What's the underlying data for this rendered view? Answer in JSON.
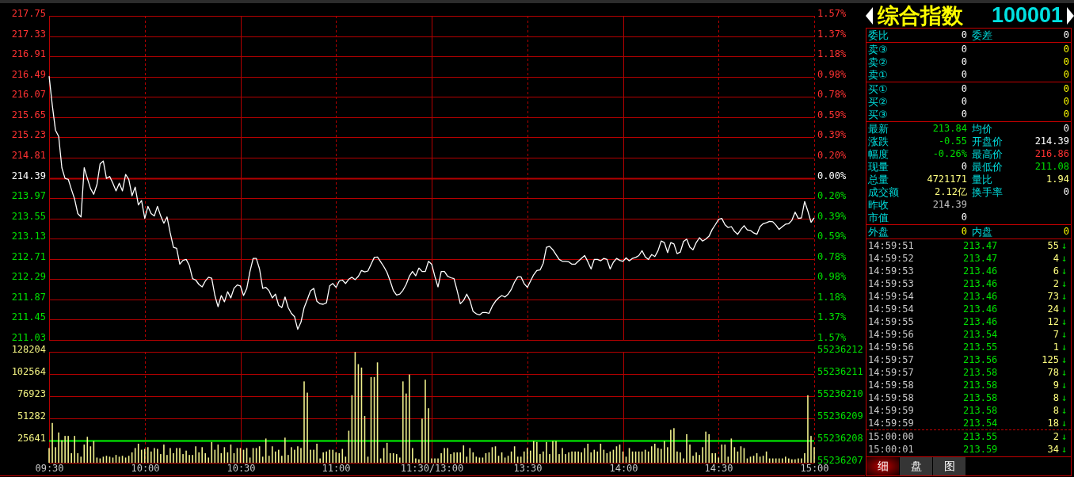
{
  "price_chart": {
    "chart_data": {
      "type": "line",
      "grid": true,
      "categories": [
        null,
        null,
        null,
        null,
        null,
        null,
        null,
        null,
        null,
        null,
        null,
        null,
        null,
        null,
        null,
        null,
        null,
        null,
        null,
        null,
        null,
        null,
        null,
        null,
        null,
        null,
        null,
        null,
        null,
        null,
        null,
        null,
        null,
        null,
        null,
        null,
        null,
        null,
        null,
        null,
        null,
        null,
        null,
        null,
        null,
        null,
        null,
        null,
        null,
        null,
        null,
        null,
        null,
        null,
        null,
        null,
        null,
        null,
        null,
        null,
        null,
        null,
        null,
        null,
        null,
        null,
        null,
        null,
        null,
        null,
        null,
        null,
        null,
        null,
        null,
        null,
        null,
        null,
        null,
        null,
        null,
        null,
        null,
        null,
        null,
        null,
        null,
        null,
        null,
        null,
        null,
        null,
        null,
        null,
        null,
        null,
        null,
        null,
        null,
        null,
        null,
        null,
        null,
        null,
        null,
        null,
        null,
        null,
        null,
        null,
        null,
        null,
        null,
        null,
        null,
        null,
        null,
        null,
        null,
        null,
        null,
        null,
        null,
        null,
        null,
        null,
        null,
        null,
        null,
        null,
        null,
        null,
        null,
        null,
        null,
        null,
        null,
        null,
        null,
        null,
        null,
        null,
        null,
        null,
        null,
        null,
        null,
        null,
        null,
        null,
        null,
        null,
        null,
        null,
        null,
        null,
        null,
        null,
        null,
        null,
        null,
        null,
        null,
        null,
        null,
        null,
        null,
        null,
        null,
        null,
        null,
        null,
        null,
        null,
        null,
        null,
        null,
        null,
        null,
        null,
        null,
        null,
        null,
        null,
        null,
        null,
        null,
        null,
        null,
        null,
        null,
        null,
        null,
        null,
        null,
        null,
        null,
        null,
        null,
        null,
        null,
        null,
        null,
        null,
        null,
        null,
        null,
        null,
        null,
        null,
        null,
        null,
        null,
        null,
        null,
        null,
        null,
        null,
        null,
        null,
        null,
        null,
        null,
        null,
        null,
        null,
        null,
        null,
        null,
        null,
        null,
        null,
        null,
        null,
        null,
        null,
        null,
        null,
        null,
        null,
        null
      ],
      "series": [
        {
          "color": "#ffffff",
          "values": [
            216.5,
            215.9,
            215.38,
            215.25,
            214.6,
            214.38,
            214.36,
            214.15,
            213.95,
            213.65,
            213.58,
            214.6,
            214.38,
            214.17,
            214.05,
            214.25,
            214.68,
            214.74,
            214.38,
            214.42,
            214.28,
            214.12,
            214.28,
            214.12,
            214.46,
            214.36,
            214.02,
            214.2,
            213.83,
            213.92,
            213.55,
            213.8,
            213.65,
            213.6,
            213.8,
            213.6,
            213.45,
            213.58,
            213.25,
            212.95,
            212.93,
            212.6,
            212.68,
            212.7,
            212.57,
            212.3,
            212.27,
            212.18,
            212.13,
            212.25,
            212.33,
            212.31,
            211.95,
            211.72,
            211.95,
            211.82,
            212.03,
            211.9,
            212.1,
            212.17,
            212.15,
            211.95,
            212.1,
            212.45,
            212.72,
            212.72,
            212.5,
            212.1,
            212.12,
            212.05,
            211.9,
            211.98,
            211.75,
            211.7,
            211.92,
            211.7,
            211.58,
            211.51,
            211.25,
            211.4,
            211.7,
            211.87,
            212.05,
            212.1,
            211.83,
            211.78,
            211.77,
            211.8,
            212.15,
            212.2,
            212.12,
            212.25,
            212.27,
            212.2,
            212.29,
            212.33,
            212.28,
            212.35,
            212.47,
            212.44,
            212.46,
            212.6,
            212.74,
            212.75,
            212.65,
            212.55,
            212.43,
            212.25,
            212.05,
            211.96,
            211.98,
            212.06,
            212.18,
            212.35,
            212.45,
            212.36,
            212.52,
            212.45,
            212.45,
            212.66,
            212.6,
            212.35,
            212.13,
            212.45,
            212.45,
            212.35,
            212.32,
            212.3,
            212.05,
            211.78,
            211.85,
            211.98,
            211.85,
            211.62,
            211.57,
            211.55,
            211.6,
            211.6,
            211.58,
            211.73,
            211.83,
            211.9,
            211.95,
            211.92,
            211.98,
            212.08,
            212.23,
            212.34,
            212.34,
            212.2,
            212.12,
            212.25,
            212.38,
            212.47,
            212.48,
            212.62,
            212.95,
            212.97,
            212.9,
            212.8,
            212.7,
            212.66,
            212.66,
            212.65,
            212.6,
            212.6,
            212.66,
            212.72,
            212.78,
            212.65,
            212.5,
            212.7,
            212.7,
            212.67,
            212.72,
            212.7,
            212.5,
            212.64,
            212.72,
            212.68,
            212.66,
            212.73,
            212.67,
            212.72,
            212.74,
            212.78,
            212.88,
            212.75,
            212.7,
            212.8,
            212.76,
            212.88,
            213.08,
            213.05,
            212.84,
            213.05,
            213.02,
            212.82,
            212.85,
            213.07,
            213.12,
            212.95,
            212.9,
            213.05,
            213.15,
            213.08,
            213.12,
            213.18,
            213.32,
            213.42,
            213.53,
            213.55,
            213.42,
            213.36,
            213.38,
            213.28,
            213.22,
            213.32,
            213.4,
            213.31,
            213.3,
            213.25,
            213.22,
            213.38,
            213.44,
            213.46,
            213.49,
            213.48,
            213.41,
            213.32,
            213.38,
            213.43,
            213.44,
            213.51,
            213.68,
            213.55,
            213.56,
            213.9,
            213.7,
            213.47,
            213.56
          ]
        }
      ],
      "ylim": [
        211.03,
        217.75
      ],
      "yticks": [
        217.75,
        217.33,
        216.91,
        216.49,
        216.07,
        215.65,
        215.23,
        214.81,
        214.39,
        213.97,
        213.55,
        213.13,
        212.71,
        212.29,
        211.87,
        211.45,
        211.03
      ],
      "ref_lines": [
        {
          "axis": "y",
          "value": 214.39,
          "color": "#b40000"
        }
      ]
    },
    "right_axis": [
      "1.57%",
      "1.37%",
      "1.18%",
      "0.98%",
      "0.78%",
      "0.59%",
      "0.39%",
      "0.20%",
      "0.00%",
      "0.20%",
      "0.39%",
      "0.59%",
      "0.78%",
      "0.98%",
      "1.18%",
      "1.37%",
      "1.57%"
    ]
  },
  "volume_chart": {
    "chart_data": {
      "type": "bar",
      "grid": true,
      "categories": [
        "09:30",
        null,
        null,
        null,
        null,
        null,
        null,
        null,
        null,
        null,
        null,
        null,
        null,
        null,
        null,
        null,
        null,
        null,
        null,
        null,
        null,
        null,
        null,
        null,
        null,
        null,
        null,
        null,
        null,
        null,
        "10:00",
        null,
        null,
        null,
        null,
        null,
        null,
        null,
        null,
        null,
        null,
        null,
        null,
        null,
        null,
        null,
        null,
        null,
        null,
        null,
        null,
        null,
        null,
        null,
        null,
        null,
        null,
        null,
        null,
        null,
        "10:30",
        null,
        null,
        null,
        null,
        null,
        null,
        null,
        null,
        null,
        null,
        null,
        null,
        null,
        null,
        null,
        null,
        null,
        null,
        null,
        null,
        null,
        null,
        null,
        null,
        null,
        null,
        null,
        null,
        null,
        "11:00",
        null,
        null,
        null,
        null,
        null,
        null,
        null,
        null,
        null,
        null,
        null,
        null,
        null,
        null,
        null,
        null,
        null,
        null,
        null,
        null,
        null,
        null,
        null,
        null,
        null,
        null,
        null,
        null,
        null,
        "11:30/13:00",
        null,
        null,
        null,
        null,
        null,
        null,
        null,
        null,
        null,
        null,
        null,
        null,
        null,
        null,
        null,
        null,
        null,
        null,
        null,
        null,
        null,
        null,
        null,
        null,
        null,
        null,
        null,
        null,
        null,
        "13:30",
        null,
        null,
        null,
        null,
        null,
        null,
        null,
        null,
        null,
        null,
        null,
        null,
        null,
        null,
        null,
        null,
        null,
        null,
        null,
        null,
        null,
        null,
        null,
        null,
        null,
        null,
        null,
        null,
        null,
        "14:00",
        null,
        null,
        null,
        null,
        null,
        null,
        null,
        null,
        null,
        null,
        null,
        null,
        null,
        null,
        null,
        null,
        null,
        null,
        null,
        null,
        null,
        null,
        null,
        null,
        null,
        null,
        null,
        null,
        null,
        "14:30",
        null,
        null,
        null,
        null,
        null,
        null,
        null,
        null,
        null,
        null,
        null,
        null,
        null,
        null,
        null,
        null,
        null,
        null,
        null,
        null,
        null,
        null,
        null,
        null,
        null,
        null,
        null,
        null,
        null,
        "15:00"
      ],
      "series": [
        {
          "color": "#f0f08c",
          "values": [
            17000,
            46000,
            18000,
            35000,
            26000,
            31000,
            31000,
            11000,
            31000,
            11000,
            7000,
            21000,
            30000,
            19000,
            25000,
            6000,
            5000,
            7000,
            8000,
            7000,
            6000,
            9000,
            7000,
            8000,
            6000,
            8000,
            12000,
            17000,
            22000,
            15000,
            16000,
            18000,
            13000,
            17000,
            16000,
            10000,
            21000,
            9000,
            17000,
            11000,
            17000,
            17000,
            10000,
            14000,
            9000,
            9000,
            19000,
            12000,
            18000,
            11000,
            6000,
            24000,
            15000,
            21000,
            11000,
            18000,
            12000,
            21000,
            11000,
            17000,
            17000,
            15000,
            17000,
            6000,
            17000,
            17000,
            19000,
            7000,
            28000,
            8000,
            19000,
            13000,
            15000,
            8000,
            29000,
            9000,
            18000,
            15000,
            19000,
            17000,
            94000,
            81000,
            15000,
            15000,
            22000,
            5000,
            12000,
            13000,
            15000,
            15000,
            12000,
            11000,
            16000,
            7000,
            37000,
            78000,
            128000,
            114000,
            110000,
            54000,
            7000,
            99000,
            99000,
            116000,
            5000,
            17000,
            23000,
            11000,
            11000,
            10000,
            6000,
            94000,
            80000,
            102000,
            17000,
            5000,
            4000,
            51000,
            96000,
            63000,
            5000,
            5000,
            5000,
            11000,
            17000,
            17000,
            10000,
            12000,
            12000,
            12000,
            20000,
            7000,
            17000,
            12000,
            7000,
            6000,
            6000,
            11000,
            12000,
            18000,
            19000,
            8000,
            12000,
            6000,
            8000,
            13000,
            19000,
            7000,
            7000,
            13000,
            17000,
            14000,
            25000,
            24000,
            10000,
            13000,
            24000,
            10000,
            25000,
            25000,
            10000,
            17000,
            10000,
            12000,
            13000,
            13000,
            13000,
            12000,
            17000,
            22000,
            12000,
            15000,
            13000,
            22000,
            15000,
            11000,
            13000,
            15000,
            19000,
            21000,
            13000,
            7000,
            17000,
            13000,
            13000,
            13000,
            13000,
            15000,
            13000,
            19000,
            22000,
            17000,
            16000,
            25000,
            18000,
            38000,
            40000,
            13000,
            12000,
            5000,
            33000,
            21000,
            8000,
            12000,
            9000,
            18000,
            36000,
            33000,
            11000,
            11000,
            6000,
            21000,
            21000,
            7000,
            28000,
            18000,
            13000,
            19000,
            17000,
            5000,
            7000,
            8000,
            11000,
            7000,
            8000,
            13000,
            5000,
            5000,
            5000,
            5000,
            5000,
            7000,
            5000,
            4000,
            4000,
            5000,
            5000,
            11000,
            78000,
            31000,
            18000
          ]
        }
      ],
      "ylim": [
        0,
        128204
      ],
      "yticks": [
        128204,
        102564,
        76923,
        51282,
        25641
      ],
      "ref_lines": [
        {
          "axis": "y",
          "value": 25641,
          "color": "#00ff00"
        }
      ]
    },
    "right_axis": [
      "55236212",
      "55236211",
      "55236210",
      "55236209",
      "55236208",
      "55236207"
    ]
  },
  "quote_panel": {
    "title": "综合指数",
    "code": "100001",
    "sections": [
      {
        "rows": [
          {
            "cells": [
              {
                "label": "委比",
                "value": "0",
                "color": "#ffffff"
              },
              {
                "label": "委差",
                "value": "0",
                "color": "#ffffff"
              }
            ]
          }
        ]
      },
      {
        "rows": [
          {
            "cells": [
              {
                "label": "卖③",
                "value": "0",
                "color": "#ffffff"
              },
              {
                "value": "0",
                "color": "#ffff00"
              }
            ]
          },
          {
            "cells": [
              {
                "label": "卖②",
                "value": "0",
                "color": "#ffffff"
              },
              {
                "value": "0",
                "color": "#ffff00"
              }
            ]
          },
          {
            "cells": [
              {
                "label": "卖①",
                "value": "0",
                "color": "#ffffff"
              },
              {
                "value": "0",
                "color": "#ffff00"
              }
            ]
          }
        ]
      },
      {
        "rows": [
          {
            "cells": [
              {
                "label": "买①",
                "value": "0",
                "color": "#ffffff"
              },
              {
                "value": "0",
                "color": "#ffff00"
              }
            ]
          },
          {
            "cells": [
              {
                "label": "买②",
                "value": "0",
                "color": "#ffffff"
              },
              {
                "value": "0",
                "color": "#ffff00"
              }
            ]
          },
          {
            "cells": [
              {
                "label": "买③",
                "value": "0",
                "color": "#ffffff"
              },
              {
                "value": "0",
                "color": "#ffff00"
              }
            ]
          }
        ]
      },
      {
        "rows": [
          {
            "cells": [
              {
                "label": "最新",
                "value": "213.84",
                "color": "#00e000"
              },
              {
                "label": "均价",
                "value": "0",
                "color": "#ffffff"
              }
            ]
          },
          {
            "cells": [
              {
                "label": "涨跌",
                "value": "-0.55",
                "color": "#00e000"
              },
              {
                "label": "开盘价",
                "value": "214.39",
                "color": "#ffffff"
              }
            ]
          },
          {
            "cells": [
              {
                "label": "幅度",
                "value": "-0.26%",
                "color": "#00e000"
              },
              {
                "label": "最高价",
                "value": "216.86",
                "color": "#ff3232"
              }
            ]
          },
          {
            "cells": [
              {
                "label": "现量",
                "value": "0",
                "color": "#ffffff"
              },
              {
                "label": "最低价",
                "value": "211.08",
                "color": "#00e000"
              }
            ]
          },
          {
            "cells": [
              {
                "label": "总量",
                "value": "4721171",
                "color": "#ffff80"
              },
              {
                "label": "量比",
                "value": "1.94",
                "color": "#ffff80"
              }
            ]
          },
          {
            "cells": [
              {
                "label": "成交额",
                "value": "2.12亿",
                "color": "#ffff80"
              },
              {
                "label": "换手率",
                "value": "0",
                "color": "#ffffff"
              }
            ]
          },
          {
            "cells": [
              {
                "label": "昨收",
                "value": "214.39",
                "color": "#c0c0c0"
              }
            ]
          },
          {
            "cells": [
              {
                "label": "市值",
                "value": "0",
                "color": "#ffffff"
              }
            ]
          }
        ]
      },
      {
        "rows": [
          {
            "cells": [
              {
                "label": "外盘",
                "value": "0",
                "color": "#ffff00"
              },
              {
                "label": "内盘",
                "value": "0",
                "color": "#ffff00"
              }
            ]
          }
        ]
      }
    ],
    "ticks": [
      {
        "time": "14:59:51",
        "price": "213.47",
        "volume": "55",
        "arrow": "↓",
        "divider_above": false
      },
      {
        "time": "14:59:52",
        "price": "213.47",
        "volume": "4",
        "arrow": "↓",
        "divider_above": false
      },
      {
        "time": "14:59:53",
        "price": "213.46",
        "volume": "6",
        "arrow": "↓",
        "divider_above": false
      },
      {
        "time": "14:59:53",
        "price": "213.46",
        "volume": "2",
        "arrow": "↓",
        "divider_above": false
      },
      {
        "time": "14:59:54",
        "price": "213.46",
        "volume": "73",
        "arrow": "↓",
        "divider_above": false
      },
      {
        "time": "14:59:54",
        "price": "213.46",
        "volume": "24",
        "arrow": "↓",
        "divider_above": false
      },
      {
        "time": "14:59:55",
        "price": "213.46",
        "volume": "12",
        "arrow": "↓",
        "divider_above": false
      },
      {
        "time": "14:59:56",
        "price": "213.54",
        "volume": "7",
        "arrow": "↓",
        "divider_above": false
      },
      {
        "time": "14:59:56",
        "price": "213.55",
        "volume": "1",
        "arrow": "↓",
        "divider_above": false
      },
      {
        "time": "14:59:57",
        "price": "213.56",
        "volume": "125",
        "arrow": "↓",
        "divider_above": false
      },
      {
        "time": "14:59:57",
        "price": "213.58",
        "volume": "78",
        "arrow": "↓",
        "divider_above": false
      },
      {
        "time": "14:59:58",
        "price": "213.58",
        "volume": "9",
        "arrow": "↓",
        "divider_above": false
      },
      {
        "time": "14:59:58",
        "price": "213.58",
        "volume": "8",
        "arrow": "↓",
        "divider_above": false
      },
      {
        "time": "14:59:59",
        "price": "213.58",
        "volume": "8",
        "arrow": "↓",
        "divider_above": false
      },
      {
        "time": "14:59:59",
        "price": "213.54",
        "volume": "18",
        "arrow": "↓",
        "divider_above": false
      },
      {
        "time": "15:00:00",
        "price": "213.55",
        "volume": "2",
        "arrow": "↓",
        "divider_above": true
      },
      {
        "time": "15:00:01",
        "price": "213.59",
        "volume": "34",
        "arrow": "↓",
        "divider_above": false
      }
    ],
    "tabs": [
      {
        "label": "细",
        "selected": true
      },
      {
        "label": "盘",
        "selected": false
      },
      {
        "label": "图",
        "selected": false
      }
    ]
  }
}
